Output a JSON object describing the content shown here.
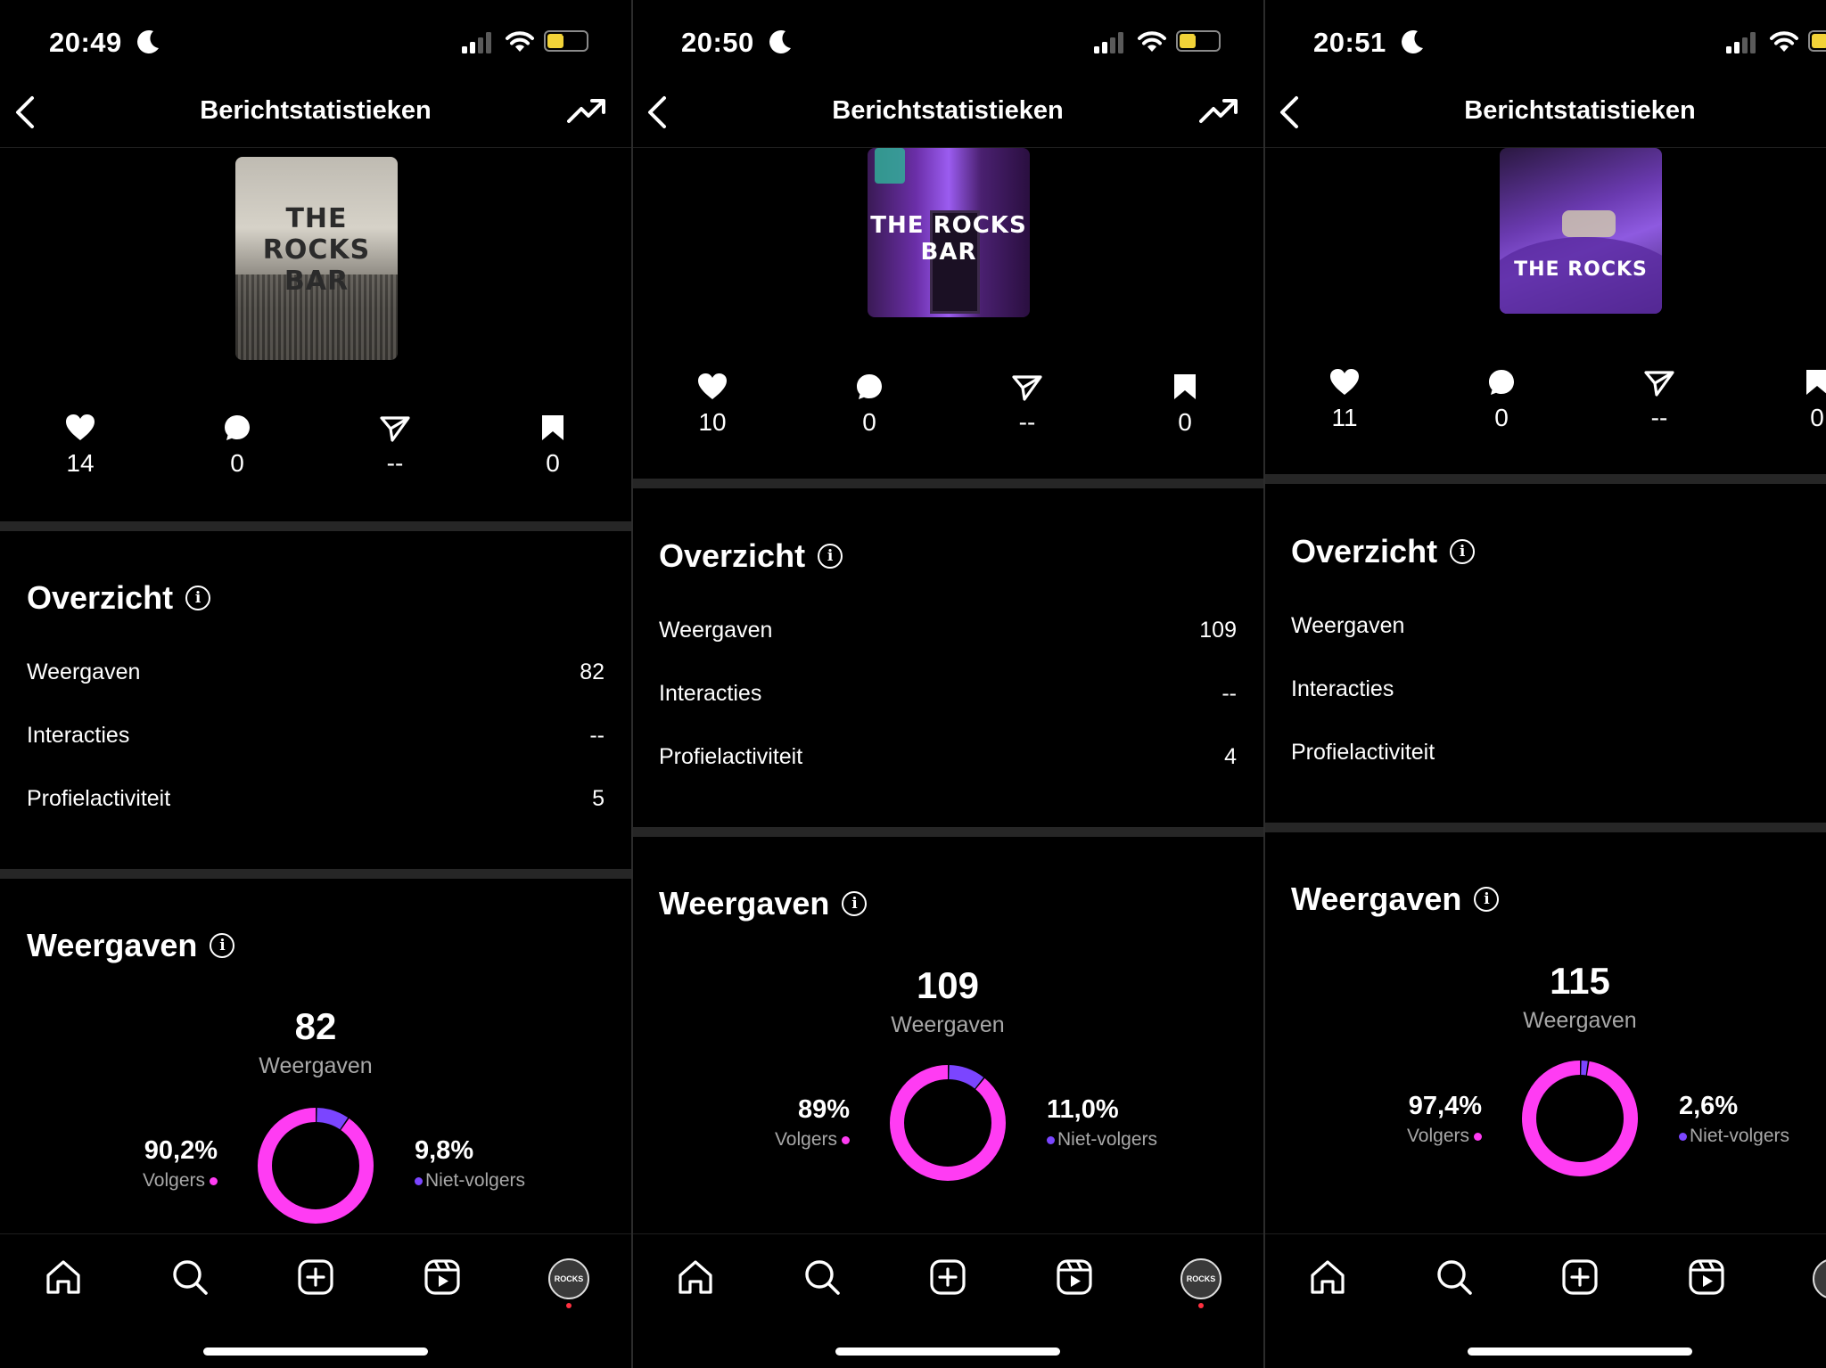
{
  "colors": {
    "followers": "#ff3cf3",
    "non_followers": "#7b45ff",
    "band": "#262626"
  },
  "screens": [
    {
      "time": "20:49",
      "battery": "7",
      "title": "Berichtstatistieken",
      "thumbnail": {
        "logo_text": "THE ROCKS BAR",
        "style": "bw-crowd"
      },
      "stats": {
        "likes": "14",
        "comments": "0",
        "shares": "--",
        "saves": "0"
      },
      "overview": {
        "title": "Overzicht",
        "rows": [
          {
            "label": "Weergaven",
            "value": "82"
          },
          {
            "label": "Interacties",
            "value": "--"
          },
          {
            "label": "Profielactiviteit",
            "value": "5"
          }
        ]
      },
      "views": {
        "title": "Weergaven",
        "total": "82",
        "total_label": "Weergaven",
        "followers_pct": "90,2%",
        "followers_label": "Volgers",
        "nonfollowers_pct": "9,8%",
        "nonfollowers_label": "Niet-volgers",
        "followers_fraction": 0.902
      },
      "nav": {
        "avatar_text": "ROCKS",
        "icons": [
          "home-icon",
          "search-icon",
          "create-icon",
          "reels-icon",
          "profile-avatar"
        ]
      }
    },
    {
      "time": "20:50",
      "battery": "7",
      "title": "Berichtstatistieken",
      "thumbnail": {
        "logo_text": "THE ROCKS BAR",
        "style": "neon-purple"
      },
      "stats": {
        "likes": "10",
        "comments": "0",
        "shares": "--",
        "saves": "0"
      },
      "overview": {
        "title": "Overzicht",
        "rows": [
          {
            "label": "Weergaven",
            "value": "109"
          },
          {
            "label": "Interacties",
            "value": "--"
          },
          {
            "label": "Profielactiviteit",
            "value": "4"
          }
        ]
      },
      "views": {
        "title": "Weergaven",
        "total": "109",
        "total_label": "Weergaven",
        "followers_pct": "89%",
        "followers_label": "Volgers",
        "nonfollowers_pct": "11,0%",
        "nonfollowers_label": "Niet-volgers",
        "followers_fraction": 0.89
      },
      "nav": {
        "avatar_text": "ROCKS"
      }
    },
    {
      "time": "20:51",
      "title": "Berichtstatistieken",
      "thumbnail": {
        "logo_text": "THE ROCKS",
        "style": "purple-bar"
      },
      "stats": {
        "likes": "11",
        "comments": "0",
        "shares": "--",
        "saves": "0"
      },
      "overview": {
        "title": "Overzicht",
        "rows": [
          {
            "label": "Weergaven",
            "value": ""
          },
          {
            "label": "Interacties",
            "value": ""
          },
          {
            "label": "Profielactiviteit",
            "value": ""
          }
        ]
      },
      "views": {
        "title": "Weergaven",
        "total": "115",
        "total_label": "Weergaven",
        "followers_pct": "97,4%",
        "followers_label": "Volgers",
        "nonfollowers_pct": "2,6%",
        "nonfollowers_label": "Niet-volgers",
        "followers_fraction": 0.974
      },
      "nav": {
        "avatar_text": ""
      }
    }
  ]
}
